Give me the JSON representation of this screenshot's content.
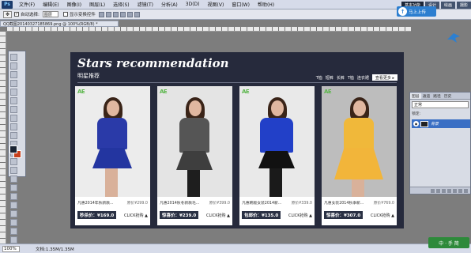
{
  "app": {
    "logo_text": "Ps"
  },
  "menubar": {
    "items": [
      "文件(F)",
      "编辑(E)",
      "图像(I)",
      "图层(L)",
      "选择(S)",
      "滤镜(T)",
      "分析(A)",
      "3D(D)",
      "视图(V)",
      "窗口(W)",
      "帮助(H)"
    ],
    "workspace_buttons": [
      "基本功能",
      "设计",
      "绘画",
      "摄影"
    ]
  },
  "options_bar": {
    "auto_select_label": "自动选择:",
    "auto_select_value": "图层",
    "show_transform_label": "显示变换控件"
  },
  "upload_badge": {
    "label": "马上上传"
  },
  "document": {
    "tab_title": "QQ截图20140327185869.png @ 100%(RGB/8) *"
  },
  "canvas": {
    "title": "Stars recommendation",
    "subtitle": "明星推荐",
    "filters": [
      "T恤",
      "短裤",
      "长裤",
      "T恤",
      "连衣裙"
    ],
    "more_button": "查看更多 ▸",
    "products": [
      {
        "brand": "AE",
        "name": "凡惠2014年秋新款...",
        "original_price": "原价¥299.0",
        "price_label": "秒杀价：¥169.0",
        "cta": "CLICK抢购 ▲",
        "colors": {
          "body": "#2a3aa8",
          "skirt": "#2335a0",
          "bg": "#ececec"
        }
      },
      {
        "brand": "AE",
        "name": "凡惠2014秋冬新款毛...",
        "original_price": "原价¥399.0",
        "price_label": "惊喜价：¥239.0",
        "cta": "CLICK抢购 ▲",
        "colors": {
          "body": "#555555",
          "skirt": "#3e3e3e",
          "bg": "#e4e4e4"
        }
      },
      {
        "brand": "AE",
        "name": "凡惠韩版女装2014新...",
        "original_price": "原价¥339.0",
        "price_label": "包邮价：¥135.0",
        "cta": "CLICK抢购 ▲",
        "colors": {
          "body": "#2240c8",
          "skirt": "#111111",
          "bg": "#e9e9e9"
        }
      },
      {
        "brand": "AE",
        "name": "凡惠女装2014秋季新...",
        "original_price": "原价¥769.0",
        "price_label": "惊喜价：¥307.0",
        "cta": "CLICK抢购 ▲",
        "colors": {
          "body": "#f0b83a",
          "skirt": "#f2b53a",
          "bg": "#bdbdbd"
        }
      }
    ]
  },
  "layers_panel": {
    "tabs": [
      "图层",
      "通道",
      "路径",
      "历史"
    ],
    "blend_mode": "正常",
    "lock_label": "锁定:",
    "layer_name": "背景"
  },
  "statusbar": {
    "zoom": "100%",
    "doc_size": "文档:1.35M/1.35M"
  },
  "watermark": {
    "label": "中 · 手 简"
  }
}
